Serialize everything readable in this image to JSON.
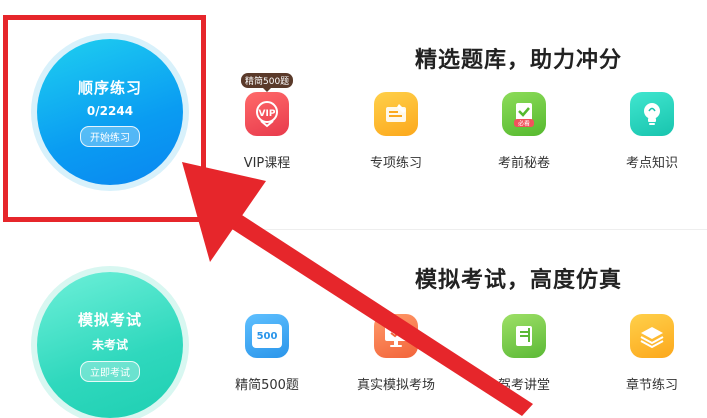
{
  "practice": {
    "title": "顺序练习",
    "progress": "0/2244",
    "button": "开始练习",
    "headline": "精选题库，助力冲分",
    "items": [
      {
        "label": "VIP课程",
        "icon": "vip-icon",
        "color": "#f2525c"
      },
      {
        "label": "专项练习",
        "icon": "edit-note-icon",
        "color": "#fdb92b"
      },
      {
        "label": "考前秘卷",
        "icon": "exam-paper-icon",
        "color": "#6bcd3f"
      },
      {
        "label": "考点知识",
        "icon": "lightbulb-icon",
        "color": "#27d6c0"
      }
    ],
    "badge": "精简500题"
  },
  "mock": {
    "title": "模拟考试",
    "status": "未考试",
    "button": "立即考试",
    "headline": "模拟考试，高度仿真",
    "items": [
      {
        "label": "精简500题",
        "icon": "500-questions-icon",
        "color": "#3aa9f2",
        "text": "500"
      },
      {
        "label": "真实模拟考场",
        "icon": "monitor-icon",
        "color": "#fb7c52"
      },
      {
        "label": "驾考讲堂",
        "icon": "book-icon",
        "color": "#76c947"
      },
      {
        "label": "章节练习",
        "icon": "layers-icon",
        "color": "#fdb92b"
      }
    ]
  },
  "colors": {
    "annotation_red": "#e6262b",
    "blue_circle": "#0a9cf2",
    "green_circle": "#2fd8bd"
  }
}
